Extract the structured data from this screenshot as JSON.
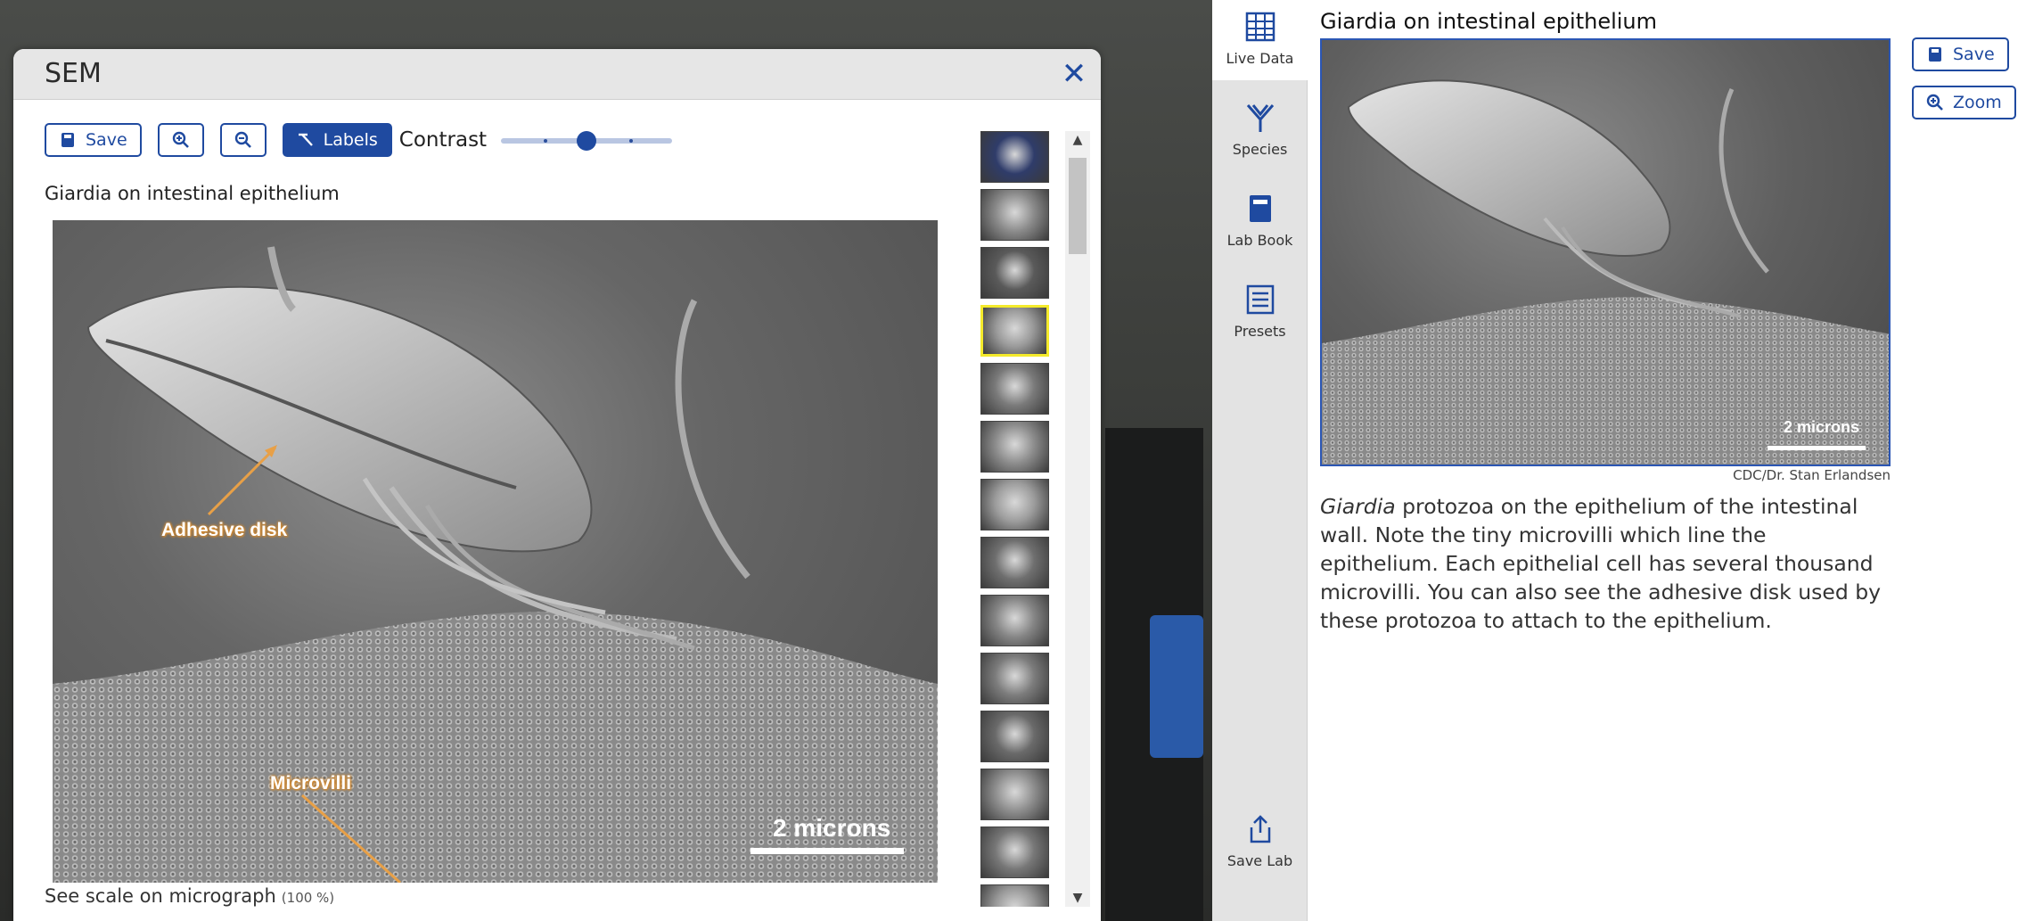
{
  "sem_window": {
    "title": "SEM",
    "toolbar": {
      "save_label": "Save",
      "labels_label": "Labels",
      "contrast_label": "Contrast",
      "contrast_value": 0.5
    },
    "caption": "Giardia on intestinal epithelium",
    "micrograph": {
      "scale_text": "2 microns",
      "label_adhesive": "Adhesive disk",
      "label_microvilli": "Microvilli"
    },
    "footer": {
      "text": "See scale on micrograph",
      "zoom": "(100 %)"
    },
    "thumbnails_count": 14,
    "selected_thumbnail": 4
  },
  "sidebar": {
    "items": [
      {
        "label": "Live Data",
        "icon": "table-icon"
      },
      {
        "label": "Species",
        "icon": "species-icon"
      },
      {
        "label": "Lab Book",
        "icon": "book-icon"
      },
      {
        "label": "Presets",
        "icon": "list-icon"
      },
      {
        "label": "Save Lab",
        "icon": "share-icon"
      }
    ]
  },
  "right_panel": {
    "title": "Giardia on intestinal epithelium",
    "scale_text": "2 microns",
    "credit": "CDC/Dr. Stan Erlandsen",
    "desc_italic": "Giardia",
    "desc_rest": " protozoa on the epithelium of the intestinal wall. Note the tiny microvilli which line the epithelium. Each epithelial cell has several thousand microvilli. You can also see the adhesive disk used by these protozoa to attach to the epithelium.",
    "save_label": "Save",
    "zoom_label": "Zoom"
  },
  "colors": {
    "accent": "#1f4aa0",
    "selected_thumb": "#f4ea2b",
    "label_glow": "#d58a2e"
  }
}
